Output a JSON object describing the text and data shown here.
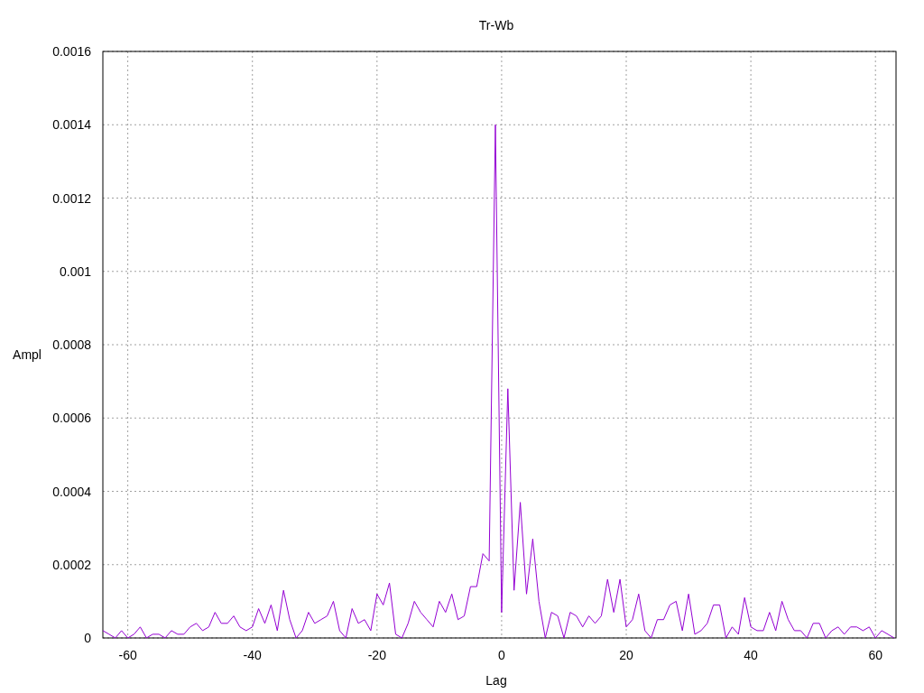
{
  "chart_data": {
    "type": "line",
    "title": "Tr-Wb",
    "xlabel": "Lag",
    "ylabel": "Ampl",
    "grid": true,
    "x": [
      -64,
      -63,
      -62,
      -61,
      -60,
      -59,
      -58,
      -57,
      -56,
      -55,
      -54,
      -53,
      -52,
      -51,
      -50,
      -49,
      -48,
      -47,
      -46,
      -45,
      -44,
      -43,
      -42,
      -41,
      -40,
      -39,
      -38,
      -37,
      -36,
      -35,
      -34,
      -33,
      -32,
      -31,
      -30,
      -29,
      -28,
      -27,
      -26,
      -25,
      -24,
      -23,
      -22,
      -21,
      -20,
      -19,
      -18,
      -17,
      -16,
      -15,
      -14,
      -13,
      -12,
      -11,
      -10,
      -9,
      -8,
      -7,
      -6,
      -5,
      -4,
      -3,
      -2,
      -1,
      0,
      1,
      2,
      3,
      4,
      5,
      6,
      7,
      8,
      9,
      10,
      11,
      12,
      13,
      14,
      15,
      16,
      17,
      18,
      19,
      20,
      21,
      22,
      23,
      24,
      25,
      26,
      27,
      28,
      29,
      30,
      31,
      32,
      33,
      34,
      35,
      36,
      37,
      38,
      39,
      40,
      41,
      42,
      43,
      44,
      45,
      46,
      47,
      48,
      49,
      50,
      51,
      52,
      53,
      54,
      55,
      56,
      57,
      58,
      59,
      60,
      61,
      62,
      63
    ],
    "series": [
      {
        "color": "#9400d3",
        "values": [
          2e-05,
          1e-05,
          0.0,
          2e-05,
          0.0,
          1e-05,
          3e-05,
          0.0,
          1e-05,
          1e-05,
          0.0,
          2e-05,
          1e-05,
          1e-05,
          3e-05,
          4e-05,
          2e-05,
          3e-05,
          7e-05,
          4e-05,
          4e-05,
          6e-05,
          3e-05,
          2e-05,
          3e-05,
          8e-05,
          4e-05,
          9e-05,
          2e-05,
          0.00013,
          5e-05,
          0.0,
          2e-05,
          7e-05,
          4e-05,
          5e-05,
          6e-05,
          0.0001,
          2e-05,
          0.0,
          8e-05,
          4e-05,
          5e-05,
          2e-05,
          0.00012,
          9e-05,
          0.00015,
          1e-05,
          0.0,
          4e-05,
          0.0001,
          7e-05,
          5e-05,
          3e-05,
          0.0001,
          7e-05,
          0.00012,
          5e-05,
          6e-05,
          0.00014,
          0.00014,
          0.00023,
          0.00021,
          0.0014,
          7e-05,
          0.00068,
          0.00013,
          0.00037,
          0.00012,
          0.00027,
          0.0001,
          0.0,
          7e-05,
          6e-05,
          0.0,
          7e-05,
          6e-05,
          3e-05,
          6e-05,
          4e-05,
          6e-05,
          0.00016,
          7e-05,
          0.00016,
          3e-05,
          5e-05,
          0.00012,
          2e-05,
          0.0,
          5e-05,
          5e-05,
          9e-05,
          0.0001,
          2e-05,
          0.00012,
          1e-05,
          2e-05,
          4e-05,
          9e-05,
          9e-05,
          0.0,
          3e-05,
          1e-05,
          0.00011,
          3e-05,
          2e-05,
          2e-05,
          7e-05,
          2e-05,
          0.0001,
          5e-05,
          2e-05,
          2e-05,
          0.0,
          4e-05,
          4e-05,
          0.0,
          2e-05,
          3e-05,
          1e-05,
          3e-05,
          3e-05,
          2e-05,
          3e-05,
          0.0,
          2e-05,
          1e-05,
          0.0
        ]
      }
    ],
    "xlim": [
      -64,
      63.3
    ],
    "ylim": [
      0,
      0.0016
    ],
    "xticks": [
      -60,
      -40,
      -20,
      0,
      20,
      40,
      60
    ],
    "yticks": [
      {
        "value": 0,
        "label": "0"
      },
      {
        "value": 0.0002,
        "label": "0.0002"
      },
      {
        "value": 0.0004,
        "label": "0.0004"
      },
      {
        "value": 0.0006,
        "label": "0.0006"
      },
      {
        "value": 0.0008,
        "label": "0.0008"
      },
      {
        "value": 0.001,
        "label": "0.001"
      },
      {
        "value": 0.0012,
        "label": "0.0012"
      },
      {
        "value": 0.0014,
        "label": "0.0014"
      },
      {
        "value": 0.0016,
        "label": "0.0016"
      }
    ]
  }
}
